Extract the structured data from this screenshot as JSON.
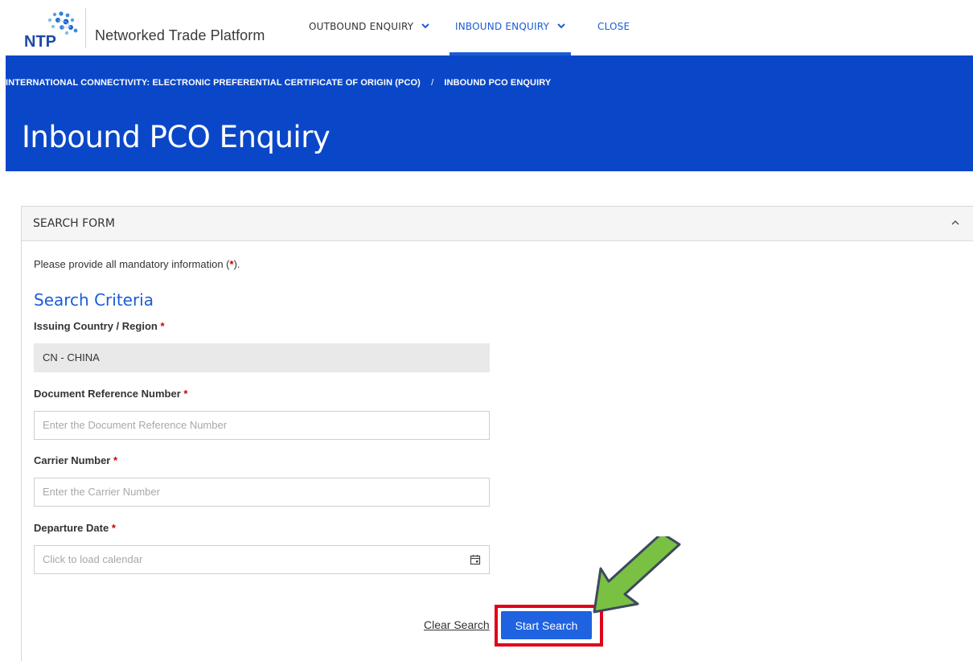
{
  "brand": {
    "logo_text": "NTP",
    "name": "Networked Trade Platform"
  },
  "nav": {
    "items": [
      {
        "label": "OUTBOUND ENQUIRY",
        "has_dropdown": true,
        "active": false
      },
      {
        "label": "INBOUND ENQUIRY",
        "has_dropdown": true,
        "active": true
      },
      {
        "label": "CLOSE",
        "has_dropdown": false,
        "active": false
      }
    ]
  },
  "breadcrumb": {
    "items": [
      "INTERNATIONAL CONNECTIVITY: ELECTRONIC PREFERENTIAL CERTIFICATE OF ORIGIN (PCO)",
      "INBOUND PCO ENQUIRY"
    ],
    "separator": "/"
  },
  "page_title": "Inbound PCO Enquiry",
  "search_form": {
    "header": "SEARCH FORM",
    "mandatory_note_prefix": "Please provide all mandatory information (",
    "mandatory_note_star": "*",
    "mandatory_note_suffix": ").",
    "criteria_title": "Search Criteria",
    "required_marker": "*",
    "fields": {
      "issuing_country": {
        "label": "Issuing Country / Region",
        "value": "CN - CHINA"
      },
      "doc_ref": {
        "label": "Document Reference Number",
        "placeholder": "Enter the Document Reference Number"
      },
      "carrier": {
        "label": "Carrier Number",
        "placeholder": "Enter the Carrier Number"
      },
      "departure": {
        "label": "Departure Date",
        "placeholder": "Click to load calendar"
      }
    },
    "clear_label": "Clear Search",
    "start_label": "Start Search"
  },
  "colors": {
    "primary": "#0a47c8",
    "link": "#1a5cd6",
    "button": "#1f63e0",
    "required": "#cc0000",
    "highlight": "#e0001b",
    "arrow": "#7ac143"
  },
  "icons": [
    "ntp-logo-icon",
    "chevron-down-icon",
    "chevron-up-icon",
    "calendar-icon",
    "annotation-arrow-icon"
  ]
}
